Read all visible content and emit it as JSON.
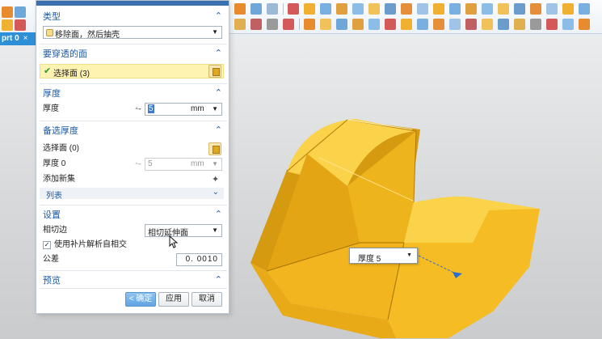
{
  "document_tab": {
    "label": "prt 0",
    "close": "×"
  },
  "dialog": {
    "type_section": {
      "title": "类型",
      "value": "移除面，然后抽壳"
    },
    "faces_section": {
      "title": "要穿透的面",
      "selected": "选择面 (3)"
    },
    "thickness_section": {
      "title": "厚度",
      "label": "厚度",
      "value": "5",
      "unit": "mm"
    },
    "alt_thickness_section": {
      "title": "备选厚度",
      "select_label": "选择面 (0)",
      "thickness_label": "厚度 0",
      "thickness_value": "5",
      "unit": "mm",
      "add_set_label": "添加新集",
      "list_label": "列表"
    },
    "settings_section": {
      "title": "设置",
      "tangent_label": "相切边",
      "tangent_value": "相切延伸面",
      "checkbox_label": "使用补片解析自相交",
      "checkbox_checked": true,
      "tolerance_label": "公差",
      "tolerance_value": "0. 0010"
    },
    "preview_section": {
      "title": "预览"
    },
    "buttons": {
      "ok": "< 确定 >",
      "apply": "应用",
      "cancel": "取消"
    }
  },
  "dimension_box": {
    "label": "厚度",
    "value": "5"
  },
  "colors": {
    "accent": "#1d5aa6",
    "selection_highlight": "#fff3b2",
    "model_yellow": "#f5b820",
    "model_dark": "#d6960c"
  }
}
